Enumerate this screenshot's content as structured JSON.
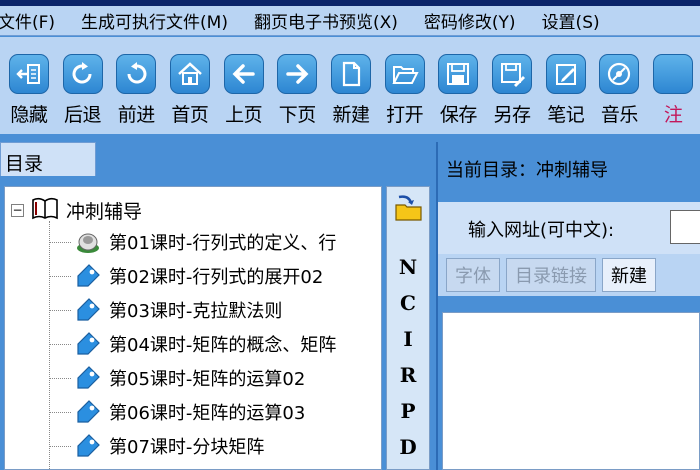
{
  "menu": [
    {
      "label": "文件(F)"
    },
    {
      "label": "生成可执行文件(M)"
    },
    {
      "label": "翻页电子书预览(X)"
    },
    {
      "label": "密码修改(Y)"
    },
    {
      "label": "设置(S)"
    }
  ],
  "toolbar": [
    {
      "label": "隐藏",
      "icon": "hide-icon"
    },
    {
      "label": "后退",
      "icon": "back-arrow-icon"
    },
    {
      "label": "前进",
      "icon": "forward-arrow-icon"
    },
    {
      "label": "首页",
      "icon": "home-icon"
    },
    {
      "label": "上页",
      "icon": "left-arrow-icon"
    },
    {
      "label": "下页",
      "icon": "right-arrow-icon"
    },
    {
      "label": "新建",
      "icon": "new-document-icon"
    },
    {
      "label": "打开",
      "icon": "open-folder-icon"
    },
    {
      "label": "保存",
      "icon": "floppy-disk-icon"
    },
    {
      "label": "另存",
      "icon": "save-as-icon"
    },
    {
      "label": "笔记",
      "icon": "notebook-icon"
    },
    {
      "label": "音乐",
      "icon": "music-disc-icon"
    },
    {
      "label": "注",
      "icon": "partial-icon"
    }
  ],
  "left_pane": {
    "header": "目录",
    "tree": {
      "root_label": "冲刺辅导",
      "expander": "−",
      "items": [
        {
          "label": "第01课时-行列式的定义、行",
          "icon": "audio-speaker-icon"
        },
        {
          "label": "第02课时-行列式的展开02",
          "icon": "tag-icon"
        },
        {
          "label": "第03课时-克拉默法则",
          "icon": "tag-icon"
        },
        {
          "label": "第04课时-矩阵的概念、矩阵",
          "icon": "tag-icon"
        },
        {
          "label": "第05课时-矩阵的运算02",
          "icon": "tag-icon"
        },
        {
          "label": "第06课时-矩阵的运算03",
          "icon": "tag-icon"
        },
        {
          "label": "第07课时-分块矩阵",
          "icon": "tag-icon"
        }
      ]
    },
    "side_strip_letters": [
      "N",
      "C",
      "I",
      "R",
      "P",
      "D"
    ]
  },
  "right_pane": {
    "current_dir": "当前目录：冲刺辅导",
    "url_label": "输入网址(可中文):",
    "url_value": "",
    "buttons": [
      {
        "label": "字体",
        "state": "disabled"
      },
      {
        "label": "目录链接",
        "state": "disabled"
      },
      {
        "label": "新建",
        "state": "enabled"
      }
    ]
  },
  "colors": {
    "window_background": "#4a8fd6",
    "toolbar_background": "#b9d4f3",
    "icon_blue": "#2d86d2"
  }
}
